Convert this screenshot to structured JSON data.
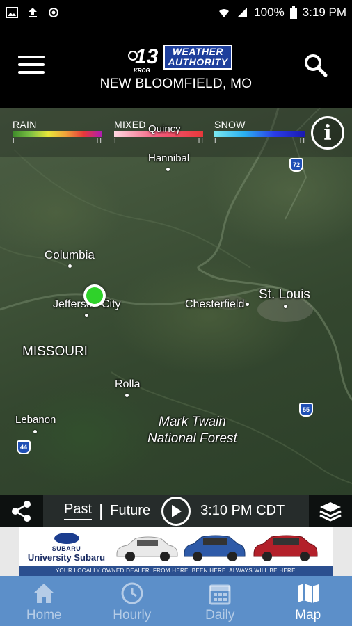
{
  "status_bar": {
    "battery": "100%",
    "time": "3:19 PM"
  },
  "header": {
    "logo_number": "13",
    "logo_sub": "KRCG",
    "logo_badge_line1": "WEATHER",
    "logo_badge_line2": "AUTHORITY",
    "location": "NEW BLOOMFIELD, MO"
  },
  "legend": {
    "rain": {
      "label": "RAIN",
      "low": "L",
      "high": "H"
    },
    "mixed": {
      "label": "MIXED",
      "low": "L",
      "high": "H"
    },
    "snow": {
      "label": "SNOW",
      "low": "L",
      "high": "H"
    },
    "colors": {
      "rain": [
        "#3d8a2a",
        "#7bc043",
        "#e8e83a",
        "#f0a13a",
        "#e8383a",
        "#b01bb0"
      ],
      "mixed": [
        "#ffd6e0",
        "#f25a7a",
        "#e8383a"
      ],
      "snow": [
        "#7ae8f0",
        "#2ab0f0",
        "#2a3ce8",
        "#1a1ab0"
      ]
    }
  },
  "map": {
    "places": {
      "quincy": "Quincy",
      "hannibal": "Hannibal",
      "columbia": "Columbia",
      "jefferson_city": "Jefferson City",
      "chesterfield": "Chesterfield",
      "st_louis": "St. Louis",
      "missouri": "MISSOURI",
      "rolla": "Rolla",
      "lebanon": "Lebanon",
      "forest_line1": "Mark Twain",
      "forest_line2": "National Forest"
    },
    "highways": {
      "i72": "72",
      "i55": "55",
      "i44": "44"
    },
    "marker_color": "#2fd22a"
  },
  "controls": {
    "past": "Past",
    "separator": "|",
    "future": "Future",
    "time": "3:10 PM CDT"
  },
  "ad": {
    "brand_sub": "SUBARU",
    "brand_name": "University Subaru",
    "footer": "YOUR LOCALLY OWNED DEALER. FROM HERE. BEEN HERE. ALWAYS WILL BE HERE."
  },
  "nav": {
    "home": "Home",
    "hourly": "Hourly",
    "daily": "Daily",
    "map": "Map"
  }
}
